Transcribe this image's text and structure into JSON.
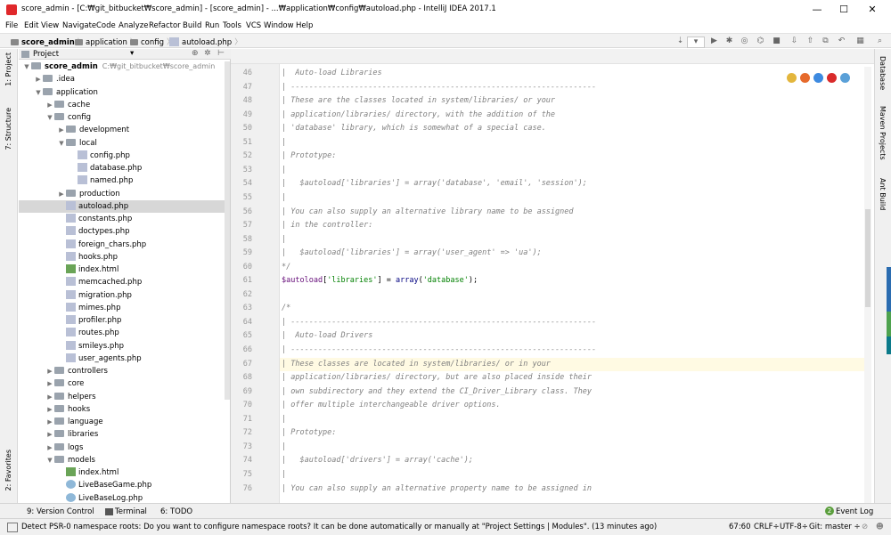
{
  "window": {
    "title": "score_admin - [C:₩git_bitbucket₩score_admin] - [score_admin] - ...₩application₩config₩autoload.php - IntelliJ IDEA 2017.1",
    "minimize": "—",
    "maximize": "☐",
    "close": "✕"
  },
  "menu": [
    "File",
    "Edit",
    "View",
    "Navigate",
    "Code",
    "Analyze",
    "Refactor",
    "Build",
    "Run",
    "Tools",
    "VCS",
    "Window",
    "Help"
  ],
  "breadcrumbs": [
    "score_admin",
    "application",
    "config",
    "autoload.php"
  ],
  "project_panel": {
    "title": "Project",
    "dropdown": "▾",
    "tree": [
      {
        "label": "score_admin",
        "note": "C:₩git_bitbucket₩score_admin",
        "depth": 0,
        "kind": "module",
        "arrow": "▼"
      },
      {
        "label": ".idea",
        "depth": 1,
        "kind": "folder",
        "arrow": "▶"
      },
      {
        "label": "application",
        "depth": 1,
        "kind": "folder",
        "arrow": "▼"
      },
      {
        "label": "cache",
        "depth": 2,
        "kind": "folder",
        "arrow": "▶"
      },
      {
        "label": "config",
        "depth": 2,
        "kind": "folder",
        "arrow": "▼"
      },
      {
        "label": "development",
        "depth": 3,
        "kind": "folder",
        "arrow": "▶"
      },
      {
        "label": "local",
        "depth": 3,
        "kind": "folder",
        "arrow": "▼"
      },
      {
        "label": "config.php",
        "depth": 4,
        "kind": "php",
        "arrow": ""
      },
      {
        "label": "database.php",
        "depth": 4,
        "kind": "php",
        "arrow": ""
      },
      {
        "label": "named.php",
        "depth": 4,
        "kind": "php",
        "arrow": ""
      },
      {
        "label": "production",
        "depth": 3,
        "kind": "folder",
        "arrow": "▶"
      },
      {
        "label": "autoload.php",
        "depth": 3,
        "kind": "php",
        "arrow": "",
        "selected": true
      },
      {
        "label": "constants.php",
        "depth": 3,
        "kind": "php",
        "arrow": ""
      },
      {
        "label": "doctypes.php",
        "depth": 3,
        "kind": "php",
        "arrow": ""
      },
      {
        "label": "foreign_chars.php",
        "depth": 3,
        "kind": "php",
        "arrow": ""
      },
      {
        "label": "hooks.php",
        "depth": 3,
        "kind": "php",
        "arrow": ""
      },
      {
        "label": "index.html",
        "depth": 3,
        "kind": "html",
        "arrow": ""
      },
      {
        "label": "memcached.php",
        "depth": 3,
        "kind": "php",
        "arrow": ""
      },
      {
        "label": "migration.php",
        "depth": 3,
        "kind": "php",
        "arrow": ""
      },
      {
        "label": "mimes.php",
        "depth": 3,
        "kind": "php",
        "arrow": ""
      },
      {
        "label": "profiler.php",
        "depth": 3,
        "kind": "php",
        "arrow": ""
      },
      {
        "label": "routes.php",
        "depth": 3,
        "kind": "php",
        "arrow": ""
      },
      {
        "label": "smileys.php",
        "depth": 3,
        "kind": "php",
        "arrow": ""
      },
      {
        "label": "user_agents.php",
        "depth": 3,
        "kind": "php",
        "arrow": ""
      },
      {
        "label": "controllers",
        "depth": 2,
        "kind": "folder",
        "arrow": "▶"
      },
      {
        "label": "core",
        "depth": 2,
        "kind": "folder",
        "arrow": "▶"
      },
      {
        "label": "helpers",
        "depth": 2,
        "kind": "folder",
        "arrow": "▶"
      },
      {
        "label": "hooks",
        "depth": 2,
        "kind": "folder",
        "arrow": "▶"
      },
      {
        "label": "language",
        "depth": 2,
        "kind": "folder",
        "arrow": "▶"
      },
      {
        "label": "libraries",
        "depth": 2,
        "kind": "folder",
        "arrow": "▶"
      },
      {
        "label": "logs",
        "depth": 2,
        "kind": "folder",
        "arrow": "▶"
      },
      {
        "label": "models",
        "depth": 2,
        "kind": "folder",
        "arrow": "▼"
      },
      {
        "label": "index.html",
        "depth": 3,
        "kind": "html",
        "arrow": ""
      },
      {
        "label": "LiveBaseGame.php",
        "depth": 3,
        "kind": "class",
        "arrow": ""
      },
      {
        "label": "LiveBaseLog.php",
        "depth": 3,
        "kind": "class",
        "arrow": ""
      }
    ]
  },
  "left_tool_tabs": [
    "1: Project",
    "7: Structure",
    "2: Favorites"
  ],
  "right_tool_tabs": [
    "Database",
    "Maven Projects",
    "Ant Build"
  ],
  "editor": {
    "current_line": 67,
    "lines": [
      {
        "n": "46",
        "t": "|  Auto-load Libraries"
      },
      {
        "n": "47",
        "t": "| -------------------------------------------------------------------"
      },
      {
        "n": "48",
        "t": "| These are the classes located in system/libraries/ or your"
      },
      {
        "n": "49",
        "t": "| application/libraries/ directory, with the addition of the"
      },
      {
        "n": "50",
        "t": "| 'database' library, which is somewhat of a special case."
      },
      {
        "n": "51",
        "t": "|"
      },
      {
        "n": "52",
        "t": "| Prototype:"
      },
      {
        "n": "53",
        "t": "|"
      },
      {
        "n": "54",
        "t": "|   $autoload['libraries'] = array('database', 'email', 'session');"
      },
      {
        "n": "55",
        "t": "|"
      },
      {
        "n": "56",
        "t": "| You can also supply an alternative library name to be assigned"
      },
      {
        "n": "57",
        "t": "| in the controller:"
      },
      {
        "n": "58",
        "t": "|"
      },
      {
        "n": "59",
        "t": "|   $autoload['libraries'] = array('user_agent' => 'ua');"
      },
      {
        "n": "60",
        "t": "*/"
      },
      {
        "n": "61",
        "t": "",
        "code": true
      },
      {
        "n": "62",
        "t": ""
      },
      {
        "n": "63",
        "t": "/*"
      },
      {
        "n": "64",
        "t": "| -------------------------------------------------------------------"
      },
      {
        "n": "65",
        "t": "|  Auto-load Drivers"
      },
      {
        "n": "66",
        "t": "| -------------------------------------------------------------------"
      },
      {
        "n": "67",
        "t": "| These classes are located in system/libraries/ or in your"
      },
      {
        "n": "68",
        "t": "| application/libraries/ directory, but are also placed inside their"
      },
      {
        "n": "69",
        "t": "| own subdirectory and they extend the CI_Driver_Library class. They"
      },
      {
        "n": "70",
        "t": "| offer multiple interchangeable driver options."
      },
      {
        "n": "71",
        "t": "|"
      },
      {
        "n": "72",
        "t": "| Prototype:"
      },
      {
        "n": "73",
        "t": "|"
      },
      {
        "n": "74",
        "t": "|   $autoload['drivers'] = array('cache');"
      },
      {
        "n": "75",
        "t": "|"
      },
      {
        "n": "76",
        "t": "| You can also supply an alternative property name to be assigned in"
      }
    ],
    "code61": {
      "var": "$autoload",
      "open": "[",
      "key": "'libraries'",
      "mid": "] = ",
      "fn": "array",
      "lp": "(",
      "val": "'database'",
      "end": ");"
    }
  },
  "bottom_tools": {
    "version_control": "9: Version Control",
    "terminal": "Terminal",
    "todo": "6: TODO",
    "event_log_count": "2",
    "event_log": "Event Log"
  },
  "status": {
    "message": "Detect PSR-0 namespace roots: Do you want to configure namespace roots? It can be done automatically or manually at \"Project Settings | Modules\". (13 minutes ago)",
    "position": "67:60",
    "line_sep": "CRLF÷",
    "encoding": "UTF-8÷",
    "git": "Git: master ÷"
  },
  "colors": {
    "accent_selection": "#d7d7d7",
    "current_line": "#fffae3",
    "comment": "#808080",
    "string": "#008000",
    "variable": "#660e7a",
    "keyword_fn": "#000080"
  }
}
